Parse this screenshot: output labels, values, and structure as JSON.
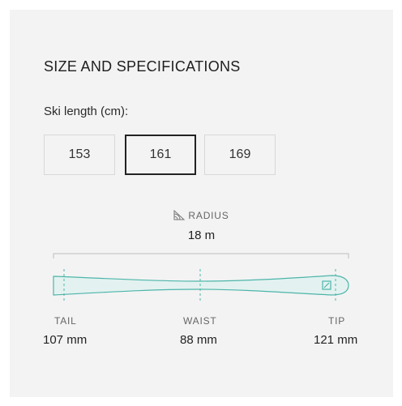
{
  "section": {
    "title": "SIZE AND SPECIFICATIONS"
  },
  "ski_length": {
    "label": "Ski length (cm):",
    "options": [
      "153",
      "161",
      "169"
    ],
    "selected": "161"
  },
  "radius": {
    "label": "RADIUS",
    "value": "18 m",
    "icon": "radius-icon"
  },
  "dimensions": {
    "tail": {
      "label": "TAIL",
      "value": "107 mm"
    },
    "waist": {
      "label": "WAIST",
      "value": "88 mm"
    },
    "tip": {
      "label": "TIP",
      "value": "121 mm"
    }
  },
  "colors": {
    "ski_fill": "#e3f2f0",
    "ski_outline": "#4db5aa",
    "selected_border": "#222222"
  }
}
